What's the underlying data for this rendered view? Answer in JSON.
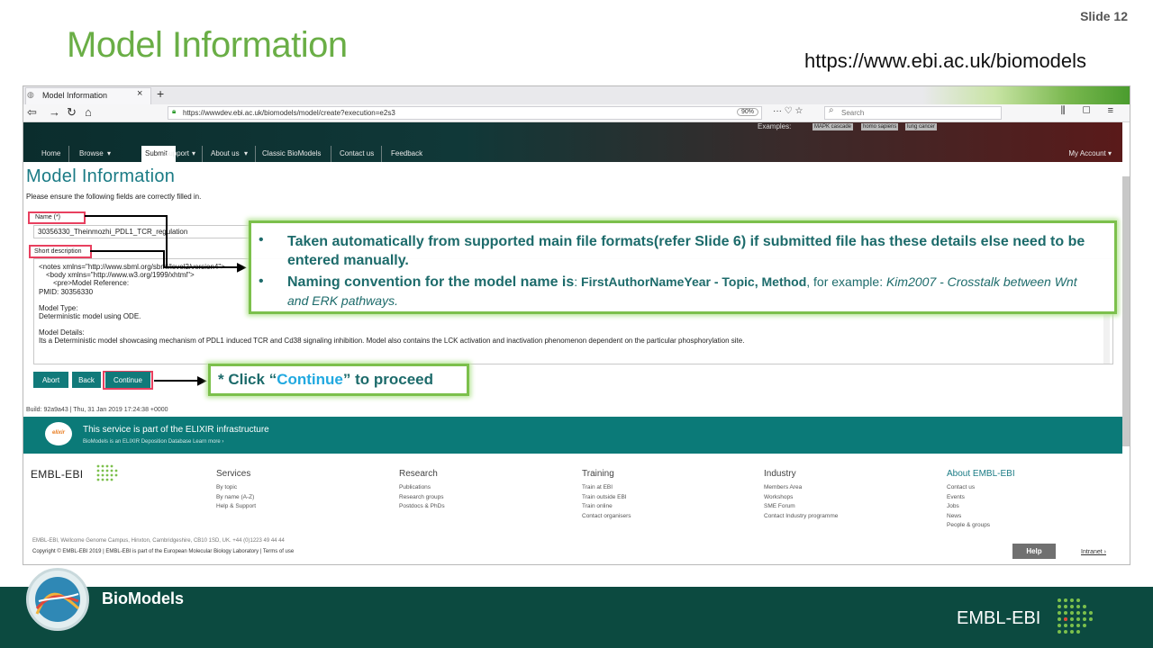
{
  "slide": {
    "number": "Slide 12",
    "title": "Model Information",
    "url": "https://www.ebi.ac.uk/biomodels"
  },
  "browser": {
    "tab_title": "Model Information",
    "address": "https://wwwdev.ebi.ac.uk/biomodels/model/create?execution=e2s3",
    "zoom": "90%",
    "search_placeholder": "Search"
  },
  "site": {
    "examples_label": "Examples:",
    "example_chips": [
      "MAPK cascade",
      "homo sapiens",
      "lung cancer"
    ],
    "nav": [
      "Home",
      "Browse",
      "Submit",
      "Support",
      "About us",
      "Classic BioModels",
      "Contact us",
      "Feedback"
    ],
    "my_account": "My Account"
  },
  "form": {
    "page_title": "Model Information",
    "instructions": "Please ensure the following fields are correctly filled in.",
    "name_label": "Name (*)",
    "name_value": "30356330_Theinmozhi_PDL1_TCR_regulation",
    "short_label": "Short description",
    "desc_line1": "<notes xmlns=\"http://www.sbml.org/sbml/level2/version4\">",
    "desc_line2": "<body xmlns=\"http://www.w3.org/1999/xhtml\">",
    "desc_line3": "<pre>Model Reference:",
    "desc_line4": "PMID: 30356330",
    "desc_type_h": "Model Type:",
    "desc_type": "Deterministic model using ODE.",
    "desc_details_h": "Model Details:",
    "desc_details": "Its a Deterministic model showcasing mechanism of PDL1 induced TCR and Cd38 signaling inhibition. Model also contains the LCK activation and inactivation phenomenon dependent on the particular phosphorylation site.",
    "buttons": {
      "abort": "Abort",
      "back": "Back",
      "continue": "Continue"
    }
  },
  "callout": {
    "bullet": "•",
    "b1": "Taken automatically from supported main file formats(refer Slide 6) if submitted file has these details else need to be entered manually.",
    "b2_lead": "Naming convention for the model name is",
    "b2_colon": ": ",
    "b2_convention": "FirstAuthorNameYear - Topic, Method",
    "b2_mid": ", for example: ",
    "b2_example": "Kim2007 - Crosstalk between Wnt and ERK pathways.",
    "continue_pre": "* Click “",
    "continue_word": "Continue",
    "continue_post": "” to proceed"
  },
  "footer": {
    "build": "Build: 92a9a43 | Thu, 31 Jan 2019 17:24:38 +0000",
    "elixir_logo": "elixir",
    "elixir_title": "This service is part of the ELIXIR infrastructure",
    "elixir_sub": "BioModels is an ELIXIR Deposition Database Learn more ›",
    "ebi_logo": "EMBL-EBI",
    "columns": [
      {
        "heading": "Services",
        "items": [
          "By topic",
          "By name (A-Z)",
          "Help & Support"
        ]
      },
      {
        "heading": "Research",
        "items": [
          "Publications",
          "Research groups",
          "Postdocs & PhDs"
        ]
      },
      {
        "heading": "Training",
        "items": [
          "Train at EBI",
          "Train outside EBI",
          "Train online",
          "Contact organisers"
        ]
      },
      {
        "heading": "Industry",
        "items": [
          "Members Area",
          "Workshops",
          "SME Forum",
          "Contact Industry programme"
        ]
      },
      {
        "heading": "About EMBL-EBI",
        "items": [
          "Contact us",
          "Events",
          "Jobs",
          "News",
          "People & groups"
        ]
      }
    ],
    "address": "EMBL-EBI, Wellcome Genome Campus, Hinxton, Cambridgeshire, CB10 1SD, UK. +44 (0)1223 49 44 44",
    "copyright": "Copyright © EMBL-EBI 2019 | EMBL-EBI is part of the European Molecular Biology Laboratory | Terms of use",
    "help": "Help",
    "intranet": "Intranet ›"
  },
  "slide_footer": {
    "brand": "BioModels",
    "org": "EMBL-EBI"
  },
  "colors": {
    "title_green": "#6aae46",
    "teal": "#117a7a",
    "highlight_red": "#e8405f",
    "callout_green": "#7cc04c",
    "footer_dark": "#0c4a40"
  }
}
